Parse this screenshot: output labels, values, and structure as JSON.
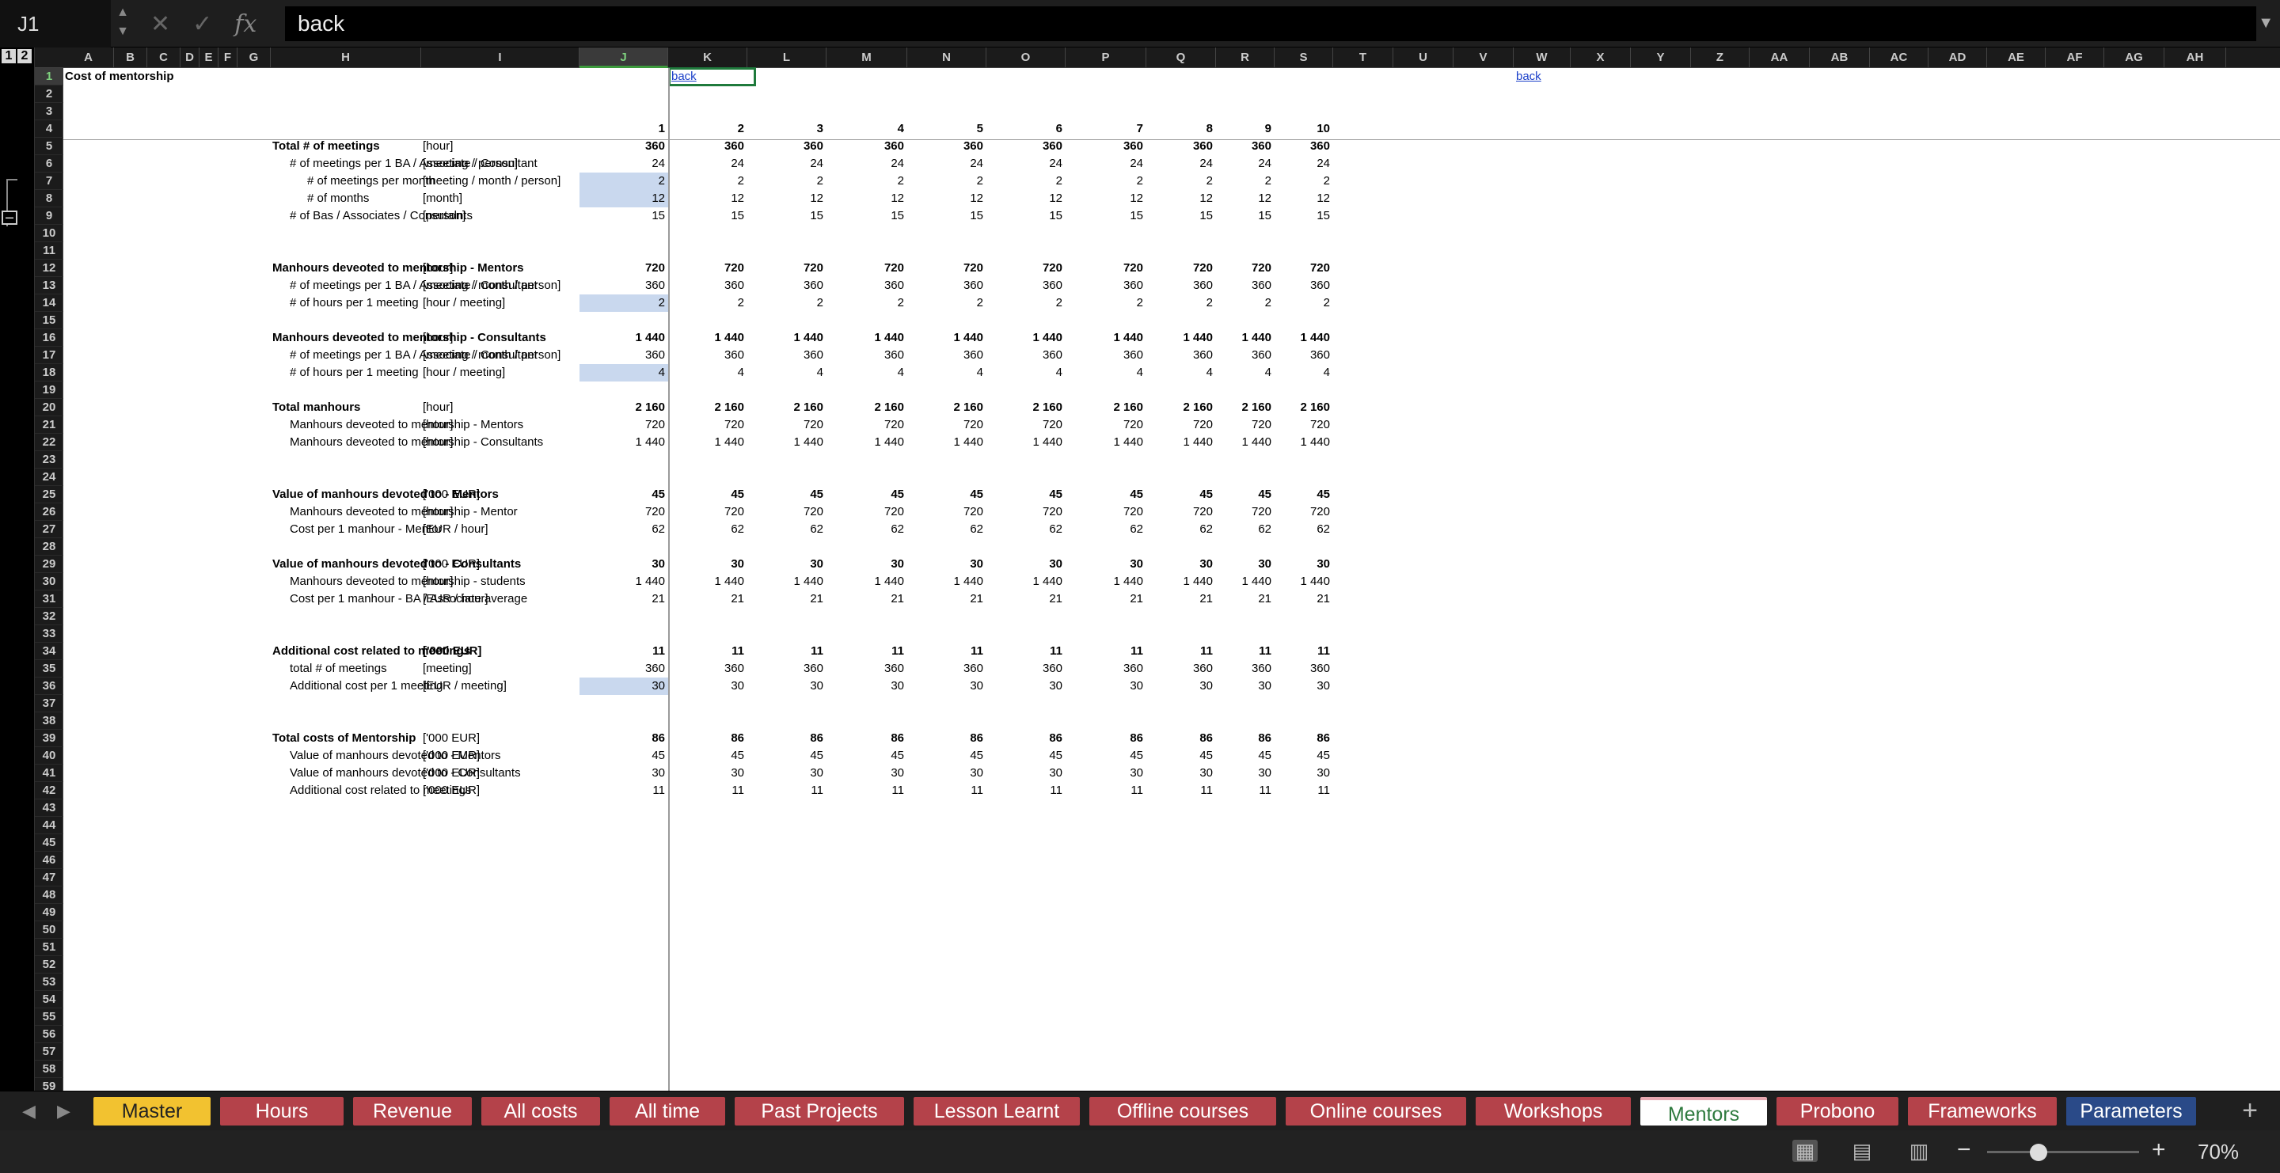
{
  "formula_bar": {
    "cell_ref": "J1",
    "formula": "back"
  },
  "outline_levels": [
    "1",
    "2"
  ],
  "columns": [
    "A",
    "B",
    "C",
    "D",
    "E",
    "F",
    "G",
    "H",
    "I",
    "J",
    "K",
    "L",
    "M",
    "N",
    "O",
    "P",
    "Q",
    "R",
    "S",
    "T",
    "U",
    "V",
    "W",
    "X",
    "Y",
    "Z",
    "AA",
    "AB",
    "AC",
    "AD",
    "AE",
    "AF",
    "AG",
    "AH"
  ],
  "sheet": {
    "title": "Cost of mentorship",
    "back_link": "back",
    "back_link2": "back",
    "periods": [
      "1",
      "2",
      "3",
      "4",
      "5",
      "6",
      "7",
      "8",
      "9",
      "10"
    ],
    "rows": [
      {
        "r": 5,
        "label": "Total # of meetings",
        "unit": "[hour]",
        "bold": true,
        "indent": 0,
        "vals": [
          "360",
          "360",
          "360",
          "360",
          "360",
          "360",
          "360",
          "360",
          "360",
          "360"
        ]
      },
      {
        "r": 6,
        "label": "# of meetings per 1 BA / Associate / Consultant",
        "unit": "[meeting / person]",
        "indent": 1,
        "vals": [
          "24",
          "24",
          "24",
          "24",
          "24",
          "24",
          "24",
          "24",
          "24",
          "24"
        ]
      },
      {
        "r": 7,
        "label": "# of meetings per month",
        "unit": "[meeting / month / person]",
        "indent": 2,
        "hl": true,
        "vals": [
          "2",
          "2",
          "2",
          "2",
          "2",
          "2",
          "2",
          "2",
          "2",
          "2"
        ]
      },
      {
        "r": 8,
        "label": "# of months",
        "unit": "[month]",
        "indent": 2,
        "hl": true,
        "vals": [
          "12",
          "12",
          "12",
          "12",
          "12",
          "12",
          "12",
          "12",
          "12",
          "12"
        ]
      },
      {
        "r": 9,
        "label": "# of Bas / Associates / Consutalnts",
        "unit": "[person]",
        "indent": 1,
        "vals": [
          "15",
          "15",
          "15",
          "15",
          "15",
          "15",
          "15",
          "15",
          "15",
          "15"
        ]
      },
      {
        "r": 12,
        "label": "Manhours deveoted to mentorship - Mentors",
        "unit": "[hour]",
        "bold": true,
        "indent": 0,
        "vals": [
          "720",
          "720",
          "720",
          "720",
          "720",
          "720",
          "720",
          "720",
          "720",
          "720"
        ]
      },
      {
        "r": 13,
        "label": "# of meetings per 1 BA / Associate / Consultant",
        "unit": "[meeting / month / person]",
        "indent": 1,
        "vals": [
          "360",
          "360",
          "360",
          "360",
          "360",
          "360",
          "360",
          "360",
          "360",
          "360"
        ]
      },
      {
        "r": 14,
        "label": "# of hours per 1 meeting",
        "unit": "[hour / meeting]",
        "indent": 1,
        "hl": true,
        "vals": [
          "2",
          "2",
          "2",
          "2",
          "2",
          "2",
          "2",
          "2",
          "2",
          "2"
        ]
      },
      {
        "r": 16,
        "label": "Manhours deveoted to mentorship - Consultants",
        "unit": "[hour]",
        "bold": true,
        "indent": 0,
        "vals": [
          "1 440",
          "1 440",
          "1 440",
          "1 440",
          "1 440",
          "1 440",
          "1 440",
          "1 440",
          "1 440",
          "1 440"
        ]
      },
      {
        "r": 17,
        "label": "# of meetings per 1 BA / Associate / Consultant",
        "unit": "[meeting / month / person]",
        "indent": 1,
        "vals": [
          "360",
          "360",
          "360",
          "360",
          "360",
          "360",
          "360",
          "360",
          "360",
          "360"
        ]
      },
      {
        "r": 18,
        "label": "# of hours per 1 meeting",
        "unit": "[hour / meeting]",
        "indent": 1,
        "hl": true,
        "vals": [
          "4",
          "4",
          "4",
          "4",
          "4",
          "4",
          "4",
          "4",
          "4",
          "4"
        ]
      },
      {
        "r": 20,
        "label": "Total manhours",
        "unit": "[hour]",
        "bold": true,
        "indent": 0,
        "vals": [
          "2 160",
          "2 160",
          "2 160",
          "2 160",
          "2 160",
          "2 160",
          "2 160",
          "2 160",
          "2 160",
          "2 160"
        ]
      },
      {
        "r": 21,
        "label": "Manhours deveoted to mentorship - Mentors",
        "unit": "[hour]",
        "indent": 1,
        "vals": [
          "720",
          "720",
          "720",
          "720",
          "720",
          "720",
          "720",
          "720",
          "720",
          "720"
        ]
      },
      {
        "r": 22,
        "label": "Manhours deveoted to mentorship - Consultants",
        "unit": "[hour]",
        "indent": 1,
        "vals": [
          "1 440",
          "1 440",
          "1 440",
          "1 440",
          "1 440",
          "1 440",
          "1 440",
          "1 440",
          "1 440",
          "1 440"
        ]
      },
      {
        "r": 25,
        "label": "Value of manhours devoted to - Mentors",
        "unit": "['000 EUR]",
        "bold": true,
        "indent": 0,
        "vals": [
          "45",
          "45",
          "45",
          "45",
          "45",
          "45",
          "45",
          "45",
          "45",
          "45"
        ]
      },
      {
        "r": 26,
        "label": "Manhours deveoted to mentorship - Mentor",
        "unit": "[hour]",
        "indent": 1,
        "vals": [
          "720",
          "720",
          "720",
          "720",
          "720",
          "720",
          "720",
          "720",
          "720",
          "720"
        ]
      },
      {
        "r": 27,
        "label": "Cost per 1 manhour - Mentor",
        "unit": "[EUR / hour]",
        "indent": 1,
        "vals": [
          "62",
          "62",
          "62",
          "62",
          "62",
          "62",
          "62",
          "62",
          "62",
          "62"
        ]
      },
      {
        "r": 29,
        "label": "Value of manhours devoted to - Consultants",
        "unit": "['000 EUR]",
        "bold": true,
        "indent": 0,
        "vals": [
          "30",
          "30",
          "30",
          "30",
          "30",
          "30",
          "30",
          "30",
          "30",
          "30"
        ]
      },
      {
        "r": 30,
        "label": "Manhours deveoted to mentorship - students",
        "unit": "[hour]",
        "indent": 1,
        "vals": [
          "1 440",
          "1 440",
          "1 440",
          "1 440",
          "1 440",
          "1 440",
          "1 440",
          "1 440",
          "1 440",
          "1 440"
        ]
      },
      {
        "r": 31,
        "label": "Cost per 1 manhour - BA / Associate average",
        "unit": "[EUR / hour]",
        "indent": 1,
        "vals": [
          "21",
          "21",
          "21",
          "21",
          "21",
          "21",
          "21",
          "21",
          "21",
          "21"
        ]
      },
      {
        "r": 34,
        "label": "Additional cost related to meetings",
        "unit": "['000 EUR]",
        "bold": true,
        "unitbold": true,
        "indent": 0,
        "vals": [
          "11",
          "11",
          "11",
          "11",
          "11",
          "11",
          "11",
          "11",
          "11",
          "11"
        ]
      },
      {
        "r": 35,
        "label": "total # of meetings",
        "unit": "[meeting]",
        "indent": 1,
        "vals": [
          "360",
          "360",
          "360",
          "360",
          "360",
          "360",
          "360",
          "360",
          "360",
          "360"
        ]
      },
      {
        "r": 36,
        "label": "Additional cost per 1 meeting",
        "unit": "[EUR / meeting]",
        "indent": 1,
        "hl": true,
        "vals": [
          "30",
          "30",
          "30",
          "30",
          "30",
          "30",
          "30",
          "30",
          "30",
          "30"
        ]
      },
      {
        "r": 39,
        "label": "Total costs of Mentorship",
        "unit": "['000 EUR]",
        "bold": true,
        "indent": 0,
        "vals": [
          "86",
          "86",
          "86",
          "86",
          "86",
          "86",
          "86",
          "86",
          "86",
          "86"
        ]
      },
      {
        "r": 40,
        "label": "Value of manhours devoted to - Mentors",
        "unit": "['000 EUR]",
        "indent": 1,
        "vals": [
          "45",
          "45",
          "45",
          "45",
          "45",
          "45",
          "45",
          "45",
          "45",
          "45"
        ]
      },
      {
        "r": 41,
        "label": "Value of manhours devoted to - Consultants",
        "unit": "['000 EUR]",
        "indent": 1,
        "vals": [
          "30",
          "30",
          "30",
          "30",
          "30",
          "30",
          "30",
          "30",
          "30",
          "30"
        ]
      },
      {
        "r": 42,
        "label": "Additional cost related to meetings",
        "unit": "['000 EUR]",
        "indent": 1,
        "vals": [
          "11",
          "11",
          "11",
          "11",
          "11",
          "11",
          "11",
          "11",
          "11",
          "11"
        ]
      }
    ]
  },
  "tabs": [
    {
      "label": "Master",
      "style": "master"
    },
    {
      "label": "Hours",
      "style": "red"
    },
    {
      "label": "Revenue",
      "style": "red"
    },
    {
      "label": "All costs",
      "style": "red"
    },
    {
      "label": "All time",
      "style": "red"
    },
    {
      "label": "Past Projects",
      "style": "red"
    },
    {
      "label": "Lesson Learnt",
      "style": "red"
    },
    {
      "label": "Offline courses",
      "style": "red"
    },
    {
      "label": "Online courses",
      "style": "red"
    },
    {
      "label": "Workshops",
      "style": "red"
    },
    {
      "label": "Mentors",
      "style": "active"
    },
    {
      "label": "Probono",
      "style": "red"
    },
    {
      "label": "Frameworks",
      "style": "red"
    },
    {
      "label": "Parameters",
      "style": "param"
    }
  ],
  "status": {
    "zoom": "70%"
  },
  "colors": {
    "highlight": "#c9d8ee",
    "selection": "#1f7a3c",
    "tab_red": "#b4424a",
    "tab_master": "#f2c230",
    "tab_param": "#2a4a88"
  }
}
